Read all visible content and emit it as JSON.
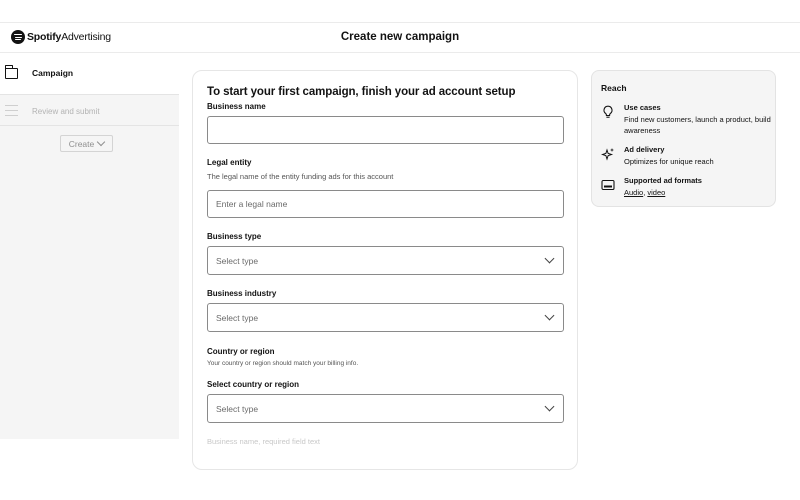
{
  "header": {
    "brand": "Spotify",
    "product": "Advertising",
    "title": "Create new campaign"
  },
  "sidebar": {
    "steps": [
      {
        "label": "Campaign",
        "icon": "folder-icon",
        "active": true
      },
      {
        "label": "Review and submit",
        "icon": "list-icon",
        "active": false
      }
    ],
    "create_label": "Create"
  },
  "form": {
    "title": "To start your first campaign, finish your ad account setup",
    "business_name": {
      "label": "Business name",
      "value": ""
    },
    "legal_entity": {
      "label": "Legal entity",
      "help": "The legal name of the entity funding ads for this account",
      "placeholder": "Enter a legal name"
    },
    "business_type": {
      "label": "Business type",
      "value": "Select type"
    },
    "business_industry": {
      "label": "Business industry",
      "value": "Select type"
    },
    "country": {
      "section_label": "Country or region",
      "help": "Your country or region should match your billing info.",
      "label": "Select country or region",
      "value": "Select type"
    },
    "cut_off_text": "Business name, required field text"
  },
  "reach": {
    "title": "Reach",
    "items": [
      {
        "icon": "lightbulb-icon",
        "heading": "Use cases",
        "text": "Find new customers, launch a product, build awareness"
      },
      {
        "icon": "sparkle-icon",
        "heading": "Ad delivery",
        "text": "Optimizes for unique reach"
      },
      {
        "icon": "display-icon",
        "heading": "Supported ad formats",
        "links": [
          "Audio",
          "video"
        ],
        "separator": ", "
      }
    ]
  }
}
